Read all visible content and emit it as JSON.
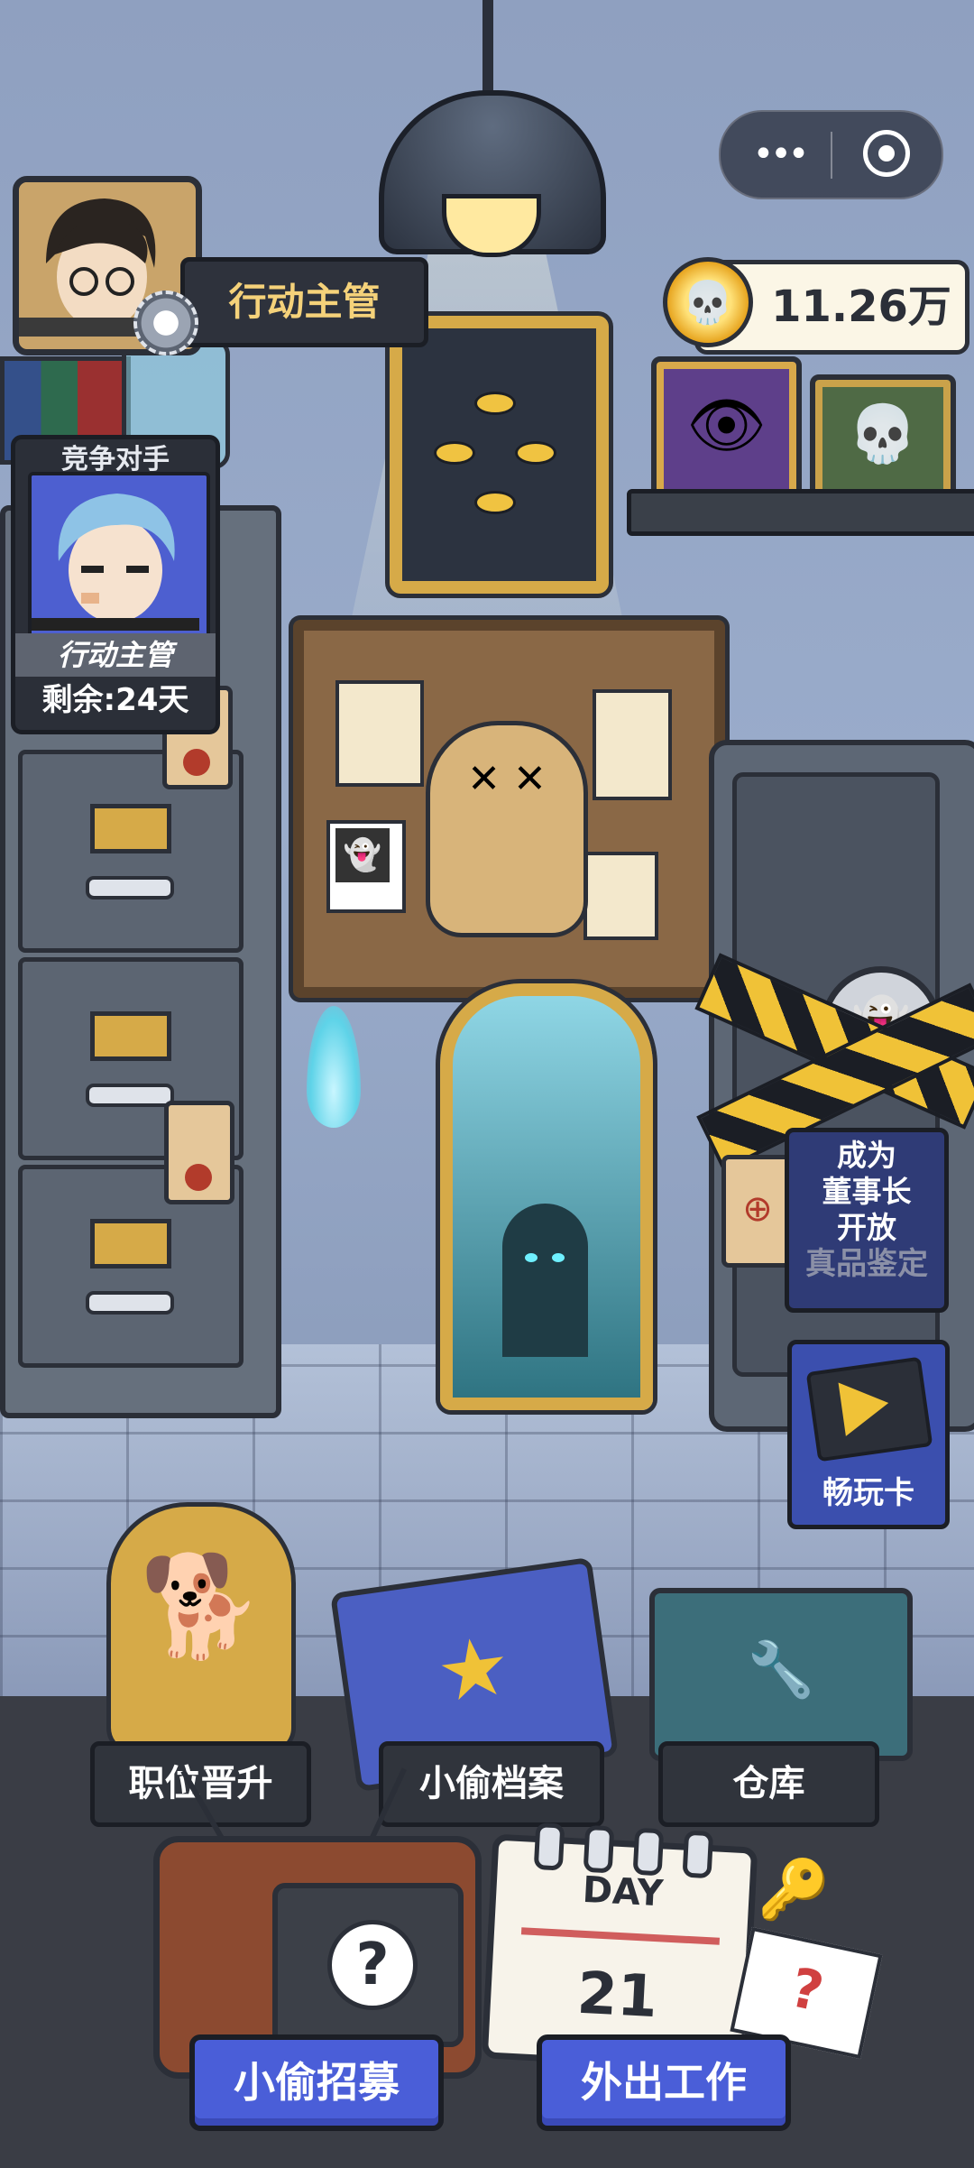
{
  "player": {
    "title": "行动主管"
  },
  "currency": {
    "value": "11.26万",
    "icon": "skull-coin-icon"
  },
  "rival": {
    "header": "竞争对手",
    "role": "行动主管",
    "days_left": "剩余:24天"
  },
  "appraisal": {
    "line1": "成为",
    "line2": "董事长",
    "line3": "开放",
    "line4": "真品鉴定"
  },
  "pass_card": {
    "label": "畅玩卡"
  },
  "menu": {
    "promotion": "职位晋升",
    "thief_files": "小偷档案",
    "warehouse": "仓库"
  },
  "calendar": {
    "top": "DAY",
    "day": "21"
  },
  "actions": {
    "recruit": "小偷招募",
    "work": "外出工作"
  },
  "colors": {
    "accent": "#4a5ed8",
    "gold": "#d6aa48",
    "panel": "#30343c"
  }
}
